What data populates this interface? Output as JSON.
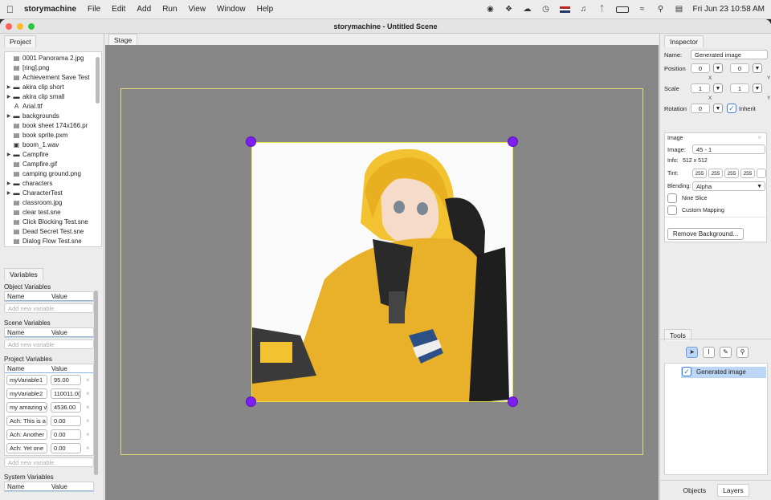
{
  "menubar": {
    "app": "storymachine",
    "items": [
      "File",
      "Edit",
      "Add",
      "Run",
      "View",
      "Window",
      "Help"
    ],
    "clock": "Fri Jun 23  10:58 AM"
  },
  "window": {
    "title": "storymachine - Untitled Scene"
  },
  "project": {
    "tab": "Project",
    "files": [
      {
        "name": "0001 Panorama 2.jpg",
        "type": "file",
        "arrow": false
      },
      {
        "name": "[ring].png",
        "type": "file",
        "arrow": false
      },
      {
        "name": "Achievement Save Test",
        "type": "file",
        "arrow": false
      },
      {
        "name": "akira clip short",
        "type": "folder",
        "arrow": true
      },
      {
        "name": "akira clip small",
        "type": "folder",
        "arrow": true
      },
      {
        "name": "Arial.ttf",
        "type": "font",
        "arrow": false
      },
      {
        "name": "backgrounds",
        "type": "folder",
        "arrow": true
      },
      {
        "name": "book sheet 174x166.pr",
        "type": "file",
        "arrow": false
      },
      {
        "name": "book sprite.pxm",
        "type": "file",
        "arrow": false
      },
      {
        "name": "boom_1.wav",
        "type": "audio",
        "arrow": false
      },
      {
        "name": "Campfire",
        "type": "folder",
        "arrow": true
      },
      {
        "name": "Campfire.gif",
        "type": "file",
        "arrow": false
      },
      {
        "name": "camping ground.png",
        "type": "file",
        "arrow": false
      },
      {
        "name": "characters",
        "type": "folder",
        "arrow": true
      },
      {
        "name": "CharacterTest",
        "type": "folder",
        "arrow": true
      },
      {
        "name": "classroom.jpg",
        "type": "file",
        "arrow": false
      },
      {
        "name": "clear test.sne",
        "type": "file",
        "arrow": false
      },
      {
        "name": "Click Blocking Test.sne",
        "type": "file",
        "arrow": false
      },
      {
        "name": "Dead Secret Test.sne",
        "type": "file",
        "arrow": false
      },
      {
        "name": "Dialog Flow Test.sne",
        "type": "file",
        "arrow": false
      }
    ]
  },
  "variables": {
    "tab": "Variables",
    "object_title": "Object Variables",
    "scene_title": "Scene Variables",
    "project_title": "Project Variables",
    "system_title": "System Variables",
    "col_name": "Name",
    "col_value": "Value",
    "add_placeholder": "Add new variable",
    "project_vars": [
      {
        "name": "myVariable1",
        "value": "95.00"
      },
      {
        "name": "myVariable2",
        "value": "110011.0("
      },
      {
        "name": "my amazing v",
        "value": "4536.00"
      },
      {
        "name": "Ach: This is a",
        "value": "0.00"
      },
      {
        "name": "Ach: Another",
        "value": "0.00"
      },
      {
        "name": "Ach: Yet one",
        "value": "0.00"
      }
    ]
  },
  "stage": {
    "tab": "Stage"
  },
  "inspector": {
    "tab": "Inspector",
    "name_label": "Name:",
    "name_value": "Generated image",
    "position_label": "Position",
    "pos_x": "0",
    "pos_y": "0",
    "scale_label": "Scale",
    "scale_x": "1",
    "scale_y": "1",
    "rotation_label": "Rotation",
    "rotation": "0",
    "inherit_label": "Inherit",
    "x_label": "X",
    "y_label": "Y",
    "image_section": "Image",
    "image_label": "Image:",
    "image_value": "45 - 1",
    "info_label": "Info:",
    "info_value": "512 x 512",
    "tint_label": "Tint:",
    "tint": [
      "255",
      "255",
      "255",
      "255"
    ],
    "blending_label": "Blending:",
    "blending_value": "Alpha",
    "nine_slice": "Nine Slice",
    "custom_mapping": "Custom Mapping",
    "remove_bg": "Remove Background..."
  },
  "tools": {
    "tab": "Tools",
    "layer_item": "Generated image",
    "bottom_tabs": [
      "Objects",
      "Layers"
    ]
  },
  "colors": {
    "handle": "#7c1ff0",
    "accent": "#3a7be0",
    "stage": "#878787"
  }
}
